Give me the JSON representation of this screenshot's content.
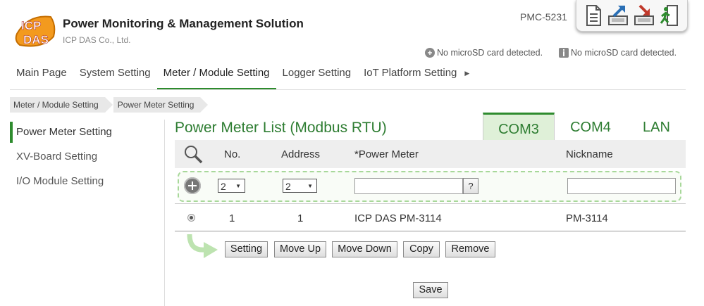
{
  "header": {
    "logo_text_top": "ICP",
    "logo_text_bottom": "DAS",
    "title": "Power Monitoring & Management Solution",
    "company": "ICP DAS Co., Ltd.",
    "model": "PMC-5231",
    "toolbar": [
      "document-icon",
      "upload-icon",
      "download-icon",
      "logout-icon"
    ],
    "sd_status_1": "No microSD card detected.",
    "sd_status_2": "No microSD card detected."
  },
  "nav": {
    "items": [
      "Main Page",
      "System Setting",
      "Meter / Module Setting",
      "Logger Setting",
      "IoT Platform Setting"
    ],
    "active": "Meter / Module Setting"
  },
  "breadcrumb": [
    "Meter / Module Setting",
    "Power Meter Setting"
  ],
  "sidebar": {
    "items": [
      "Power Meter Setting",
      "XV-Board Setting",
      "I/O Module Setting"
    ],
    "active": "Power Meter Setting"
  },
  "main": {
    "title": "Power Meter List (Modbus RTU)",
    "tabs": [
      "COM3",
      "COM4",
      "LAN"
    ],
    "active_tab": "COM3",
    "columns": [
      "No.",
      "Address",
      "*Power Meter",
      "Nickname"
    ],
    "add_row": {
      "no_value": "2",
      "address_value": "2",
      "power_meter_value": "",
      "nickname_value": "",
      "help_label": "?"
    },
    "rows": [
      {
        "no": "1",
        "address": "1",
        "power_meter": "ICP DAS PM-3114",
        "nickname": "PM-3114"
      }
    ],
    "actions": [
      "Setting",
      "Move Up",
      "Move Down",
      "Copy",
      "Remove"
    ],
    "save_label": "Save"
  },
  "colors": {
    "accent": "#2e8b2e",
    "tab_active_bg": "#dff0d8",
    "logo_orange": "#f39a1e"
  }
}
